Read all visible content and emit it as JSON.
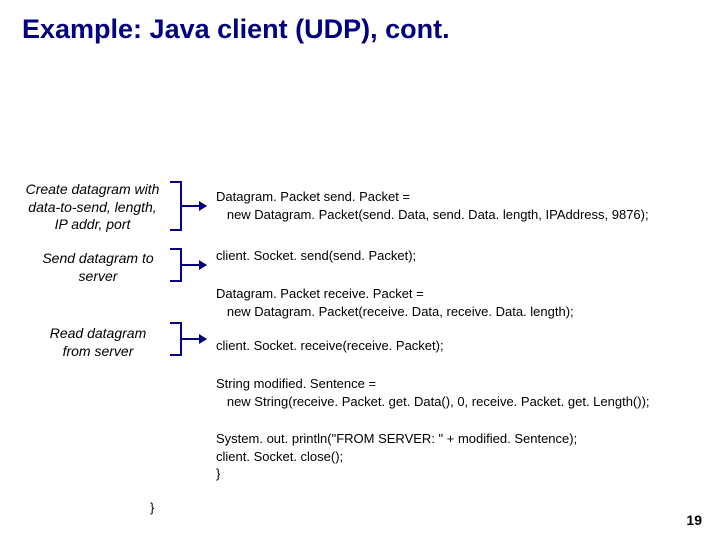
{
  "title": "Example: Java client (UDP), cont.",
  "annotations": {
    "a1": "Create datagram with data-to-send, length, IP addr, port",
    "a2": "Send datagram to server",
    "a3": "Read datagram from server"
  },
  "code": {
    "c1": "Datagram. Packet send. Packet =\n   new Datagram. Packet(send. Data, send. Data. length, IPAddress, 9876);",
    "c2": "client. Socket. send(send. Packet);",
    "c3": "Datagram. Packet receive. Packet =\n   new Datagram. Packet(receive. Data, receive. Data. length);",
    "c4": "client. Socket. receive(receive. Packet);",
    "c5": "String modified. Sentence =\n   new String(receive. Packet. get. Data(), 0, receive. Packet. get. Length());",
    "c6": "System. out. println(\"FROM SERVER: \" + modified. Sentence);\nclient. Socket. close();\n}",
    "closebrace": "}"
  },
  "page_number": "19"
}
